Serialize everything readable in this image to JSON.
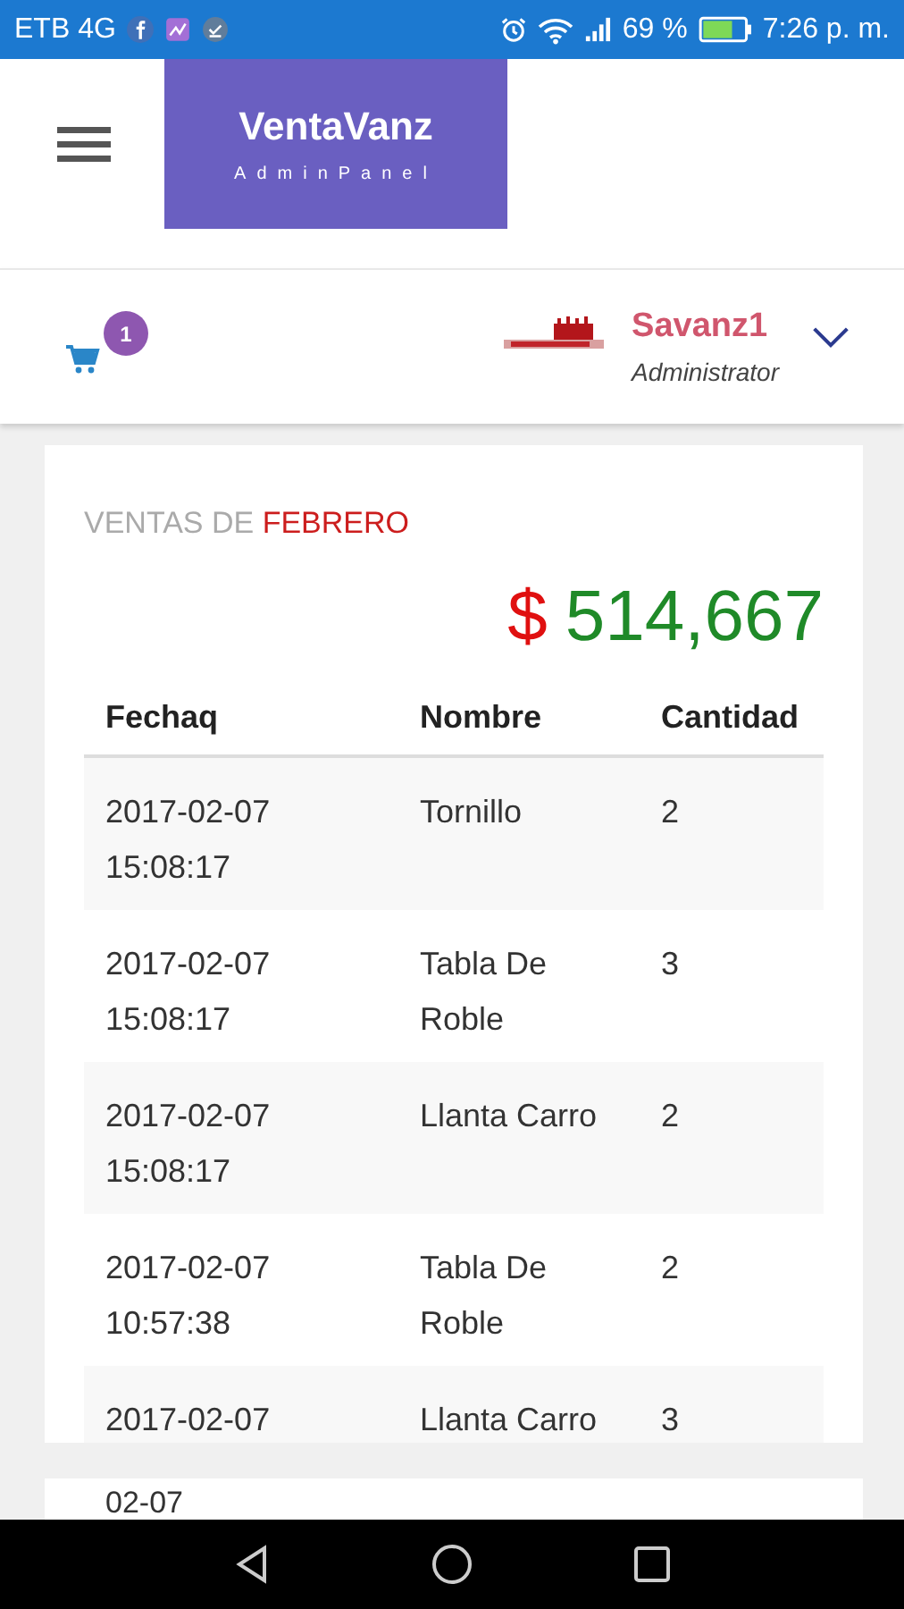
{
  "status_bar": {
    "carrier": "ETB 4G",
    "battery": "69 %",
    "time": "7:26 p. m."
  },
  "header": {
    "brand": "VentaVanz",
    "subtitle": "AdminPanel"
  },
  "user_bar": {
    "cart_count": "1",
    "user_name": "Savanz1",
    "role": "Administrator"
  },
  "sales_card": {
    "title": "VENTAS DE **FEBRERO**",
    "currency": "$",
    "amount": "514,667",
    "table": {
      "columns": [
        "Fechaq",
        "Nombre",
        "Cantidad"
      ],
      "rows": [
        {
          "date": [
            "2017-02-07",
            "15:08:17"
          ],
          "name": [
            "Tornillo"
          ],
          "qty": "2"
        },
        {
          "date": [
            "2017-02-07",
            "15:08:17"
          ],
          "name": [
            "Tabla De",
            "Roble"
          ],
          "qty": "3"
        },
        {
          "date": [
            "2017-02-07",
            "15:08:17"
          ],
          "name": [
            "Llanta Carro"
          ],
          "qty": "2"
        },
        {
          "date": [
            "2017-02-07",
            "10:57:38"
          ],
          "name": [
            "Tabla De",
            "Roble"
          ],
          "qty": "2"
        },
        {
          "date": [
            "2017-02-07"
          ],
          "name": [
            "Llanta Carro"
          ],
          "qty": "3"
        }
      ]
    }
  },
  "next_card": {
    "text": "02-07"
  }
}
